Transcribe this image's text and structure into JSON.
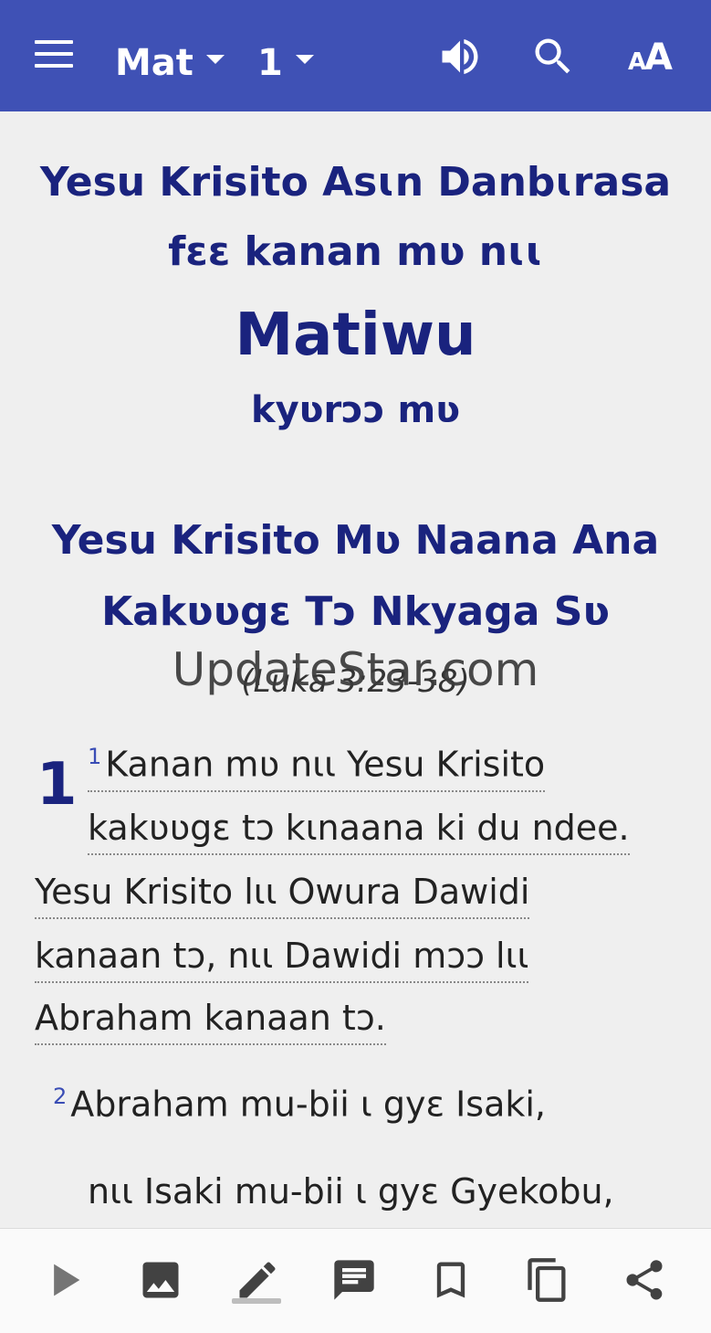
{
  "toolbar": {
    "book": "Mat",
    "chapter": "1",
    "icons": [
      "menu-icon",
      "speaker-icon",
      "search-icon",
      "font-size-icon"
    ]
  },
  "header": {
    "line1": "Yesu Krisito Asɩn Danbɩrasa",
    "line2": "fɛɛ kanan mʋ nɩɩ",
    "book_title": "Matiwu",
    "line4": "kyʋrɔɔ mʋ"
  },
  "section": {
    "heading_line1": "Yesu Krisito Mʋ Naana Ana",
    "heading_line2": "Kakʋʋgɛ Tɔ Nkyaga Sʋ",
    "reference": "(Luka 3:23-38)"
  },
  "watermark": "UpdateStar.com",
  "chapter_number": "1",
  "verses": {
    "v1_num": "1",
    "v1_line1": "Kanan mʋ nɩɩ Yesu Krisito",
    "v1_line2": "kakʋʋgɛ tɔ kɩnaana ki du ndee.",
    "v1_line3": "Yesu Krisito lɩɩ Owura Dawidi",
    "v1_line4": "kanaan tɔ, nɩɩ Dawidi mɔɔ lɩɩ",
    "v1_line5": "Abraham kanaan tɔ.",
    "v2_num": "2",
    "v2_line1": "Abraham mu-bii ɩ gyɛ Isaki,",
    "v2_line2": "nɩɩ Isaki mu-bii ɩ gyɛ Gyekobu,"
  },
  "bottom_bar": {
    "icons": [
      "play-icon",
      "image-icon",
      "edit-icon",
      "comment-icon",
      "bookmark-icon",
      "copy-icon",
      "share-icon"
    ],
    "active": "edit-icon"
  },
  "colors": {
    "app_bar": "#3f51b5",
    "title_text": "#1a237e",
    "verse_number": "#3a4db5",
    "background": "#efefef"
  }
}
